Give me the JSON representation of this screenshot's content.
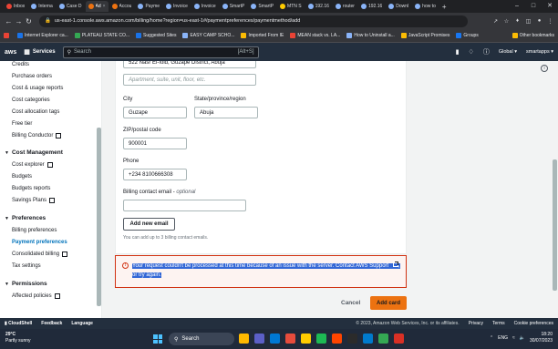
{
  "browser": {
    "tabs": [
      {
        "label": "Inbox",
        "color": "#ea4335"
      },
      {
        "label": "Interna",
        "color": "#8ab4f8"
      },
      {
        "label": "Case D",
        "color": "#8ab4f8"
      },
      {
        "label": "Ad",
        "color": "#ec7211",
        "active": true
      },
      {
        "label": "Accou",
        "color": "#ec7211"
      },
      {
        "label": "Payme",
        "color": "#8ab4f8"
      },
      {
        "label": "Invoice",
        "color": "#8ab4f8"
      },
      {
        "label": "Invoice",
        "color": "#8ab4f8"
      },
      {
        "label": "SmartP",
        "color": "#8ab4f8"
      },
      {
        "label": "SmartP",
        "color": "#8ab4f8"
      },
      {
        "label": "MTN S",
        "color": "#ffcc00"
      },
      {
        "label": "192.16",
        "color": "#8ab4f8"
      },
      {
        "label": "router",
        "color": "#8ab4f8"
      },
      {
        "label": "192.16",
        "color": "#8ab4f8"
      },
      {
        "label": "Downl",
        "color": "#8ab4f8"
      },
      {
        "label": "how to",
        "color": "#8ab4f8"
      }
    ],
    "new_tab": "+",
    "url": "us-east-1.console.aws.amazon.com/billing/home?region=us-east-1#/paymentpreferences/paymentmethod/add",
    "bookmarks": [
      {
        "label": "Internet Explorer ca...",
        "color": "#1a73e8"
      },
      {
        "label": "PLATEAU STATE CO...",
        "color": "#34a853"
      },
      {
        "label": "Suggested Sites",
        "color": "#1a73e8"
      },
      {
        "label": "EASY CAMP SCHO...",
        "color": "#8ab4f8"
      },
      {
        "label": "Imported From IE",
        "color": "#fbbc04"
      },
      {
        "label": "MEAN stack vs. LA...",
        "color": "#ea4335"
      },
      {
        "label": "How to Uninstall a...",
        "color": "#8ab4f8"
      },
      {
        "label": "JavaScript Promises",
        "color": "#fbbc04"
      },
      {
        "label": "Groups",
        "color": "#1877f2"
      }
    ],
    "other_bookmarks": "Other bookmarks"
  },
  "aws_nav": {
    "logo": "aws",
    "services": "Services",
    "search_placeholder": "Search",
    "search_shortcut": "[Alt+S]",
    "region": "Global",
    "account": "smartapps"
  },
  "sidebar": {
    "items_top": [
      "Credits",
      "Purchase orders",
      "Cost & usage reports",
      "Cost categories",
      "Cost allocation tags",
      "Free tier",
      "Billing Conductor"
    ],
    "sections": [
      {
        "title": "Cost Management",
        "items": [
          "Cost explorer",
          "Budgets",
          "Budgets reports",
          "Savings Plans"
        ]
      },
      {
        "title": "Preferences",
        "items": [
          "Billing preferences",
          "Payment preferences",
          "Consolidated billing",
          "Tax settings"
        ]
      },
      {
        "title": "Permissions",
        "items": [
          "Affected policies"
        ]
      }
    ]
  },
  "form": {
    "address_line1": "522 Nasr El-fold, Guzape District, Abuja",
    "address_line2_placeholder": "Apartment, suite, unit, floor, etc.",
    "city_label": "City",
    "city_value": "Guzape",
    "state_label": "State/province/region",
    "state_value": "Abuja",
    "zip_label": "ZIP/postal code",
    "zip_value": "900001",
    "phone_label": "Phone",
    "phone_value": "+234 8100666308",
    "billing_email_label": "Billing contact email -",
    "billing_email_optional": "optional",
    "billing_email_value": "",
    "add_email_button": "Add new email",
    "email_hint": "You can add up to 3 billing contact emails."
  },
  "error": {
    "message_part1": "Your request couldn't be processed at this time because of an issue with the server. Contact AWS Support",
    "message_part2": ", or try again."
  },
  "actions": {
    "cancel": "Cancel",
    "add_card": "Add card"
  },
  "footer": {
    "cloudshell": "CloudShell",
    "feedback": "Feedback",
    "language": "Language",
    "copyright": "© 2023, Amazon Web Services, Inc. or its affiliates.",
    "privacy": "Privacy",
    "terms": "Terms",
    "cookie": "Cookie preferences"
  },
  "taskbar": {
    "temp": "29°C",
    "weather": "Partly sunny",
    "search": "Search",
    "lang": "ENG",
    "time": "18:20",
    "date": "30/07/2023",
    "apps": [
      "#ffb900",
      "#5b5fc7",
      "#0078d4",
      "#e74c3c",
      "#ffcc00",
      "#1db954",
      "#ff4500",
      "#2b2b2b",
      "#007acc",
      "#34a853",
      "#d93025"
    ]
  },
  "colors": {
    "aws_nav": "#232f3e",
    "accent_orange": "#ec7211",
    "link_blue": "#0073bb",
    "error_red": "#d13212"
  }
}
